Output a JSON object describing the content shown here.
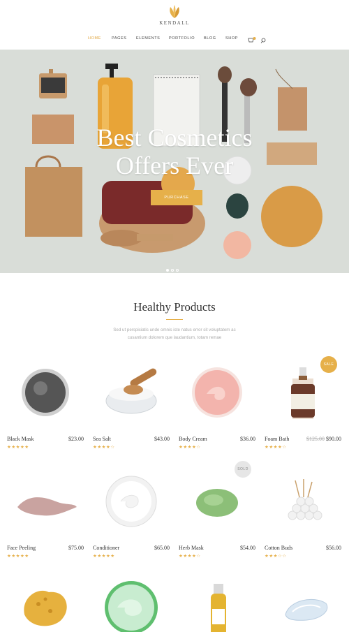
{
  "brand": {
    "name": "KENDALL",
    "accent": "#e6b04a"
  },
  "nav": {
    "items": [
      {
        "label": "HOME",
        "active": true
      },
      {
        "label": "PAGES"
      },
      {
        "label": "ELEMENTS"
      },
      {
        "label": "PORTFOLIO"
      },
      {
        "label": "BLOG"
      },
      {
        "label": "SHOP"
      }
    ],
    "cart_count": "0",
    "icons": [
      "cart-icon",
      "search-icon"
    ]
  },
  "hero": {
    "title_line1": "Best Cosmetics",
    "title_line2": "Offers Ever",
    "button_label": "PURCHASE",
    "slides": 3,
    "active_slide": 1
  },
  "section": {
    "title": "Healthy Products",
    "desc_line1": "Sed ut perspiciatis unde omnis iste natus error sit voluptatem ac",
    "desc_line2": "cusantium dolorem que laudantium, totam remae"
  },
  "products": [
    {
      "name": "Black Mask",
      "price": "$23.00",
      "rating": 5
    },
    {
      "name": "Sea Salt",
      "price": "$43.00",
      "rating": 4
    },
    {
      "name": "Body Cream",
      "price": "$36.00",
      "rating": 4
    },
    {
      "name": "Foam Bath",
      "old_price": "$125.00",
      "price": "$90.00",
      "rating": 4,
      "badge": "SALE"
    },
    {
      "name": "Face Peeling",
      "price": "$75.00",
      "rating": 4.5
    },
    {
      "name": "Conditioner",
      "price": "$65.00",
      "rating": 5
    },
    {
      "name": "Herb Mask",
      "price": "$54.00",
      "rating": 4,
      "badge": "SOLD"
    },
    {
      "name": "Cotton Buds",
      "price": "$56.00",
      "rating": 3
    },
    {
      "name": "",
      "price": ""
    },
    {
      "name": "",
      "price": ""
    },
    {
      "name": "",
      "price": ""
    },
    {
      "name": "",
      "price": ""
    }
  ]
}
